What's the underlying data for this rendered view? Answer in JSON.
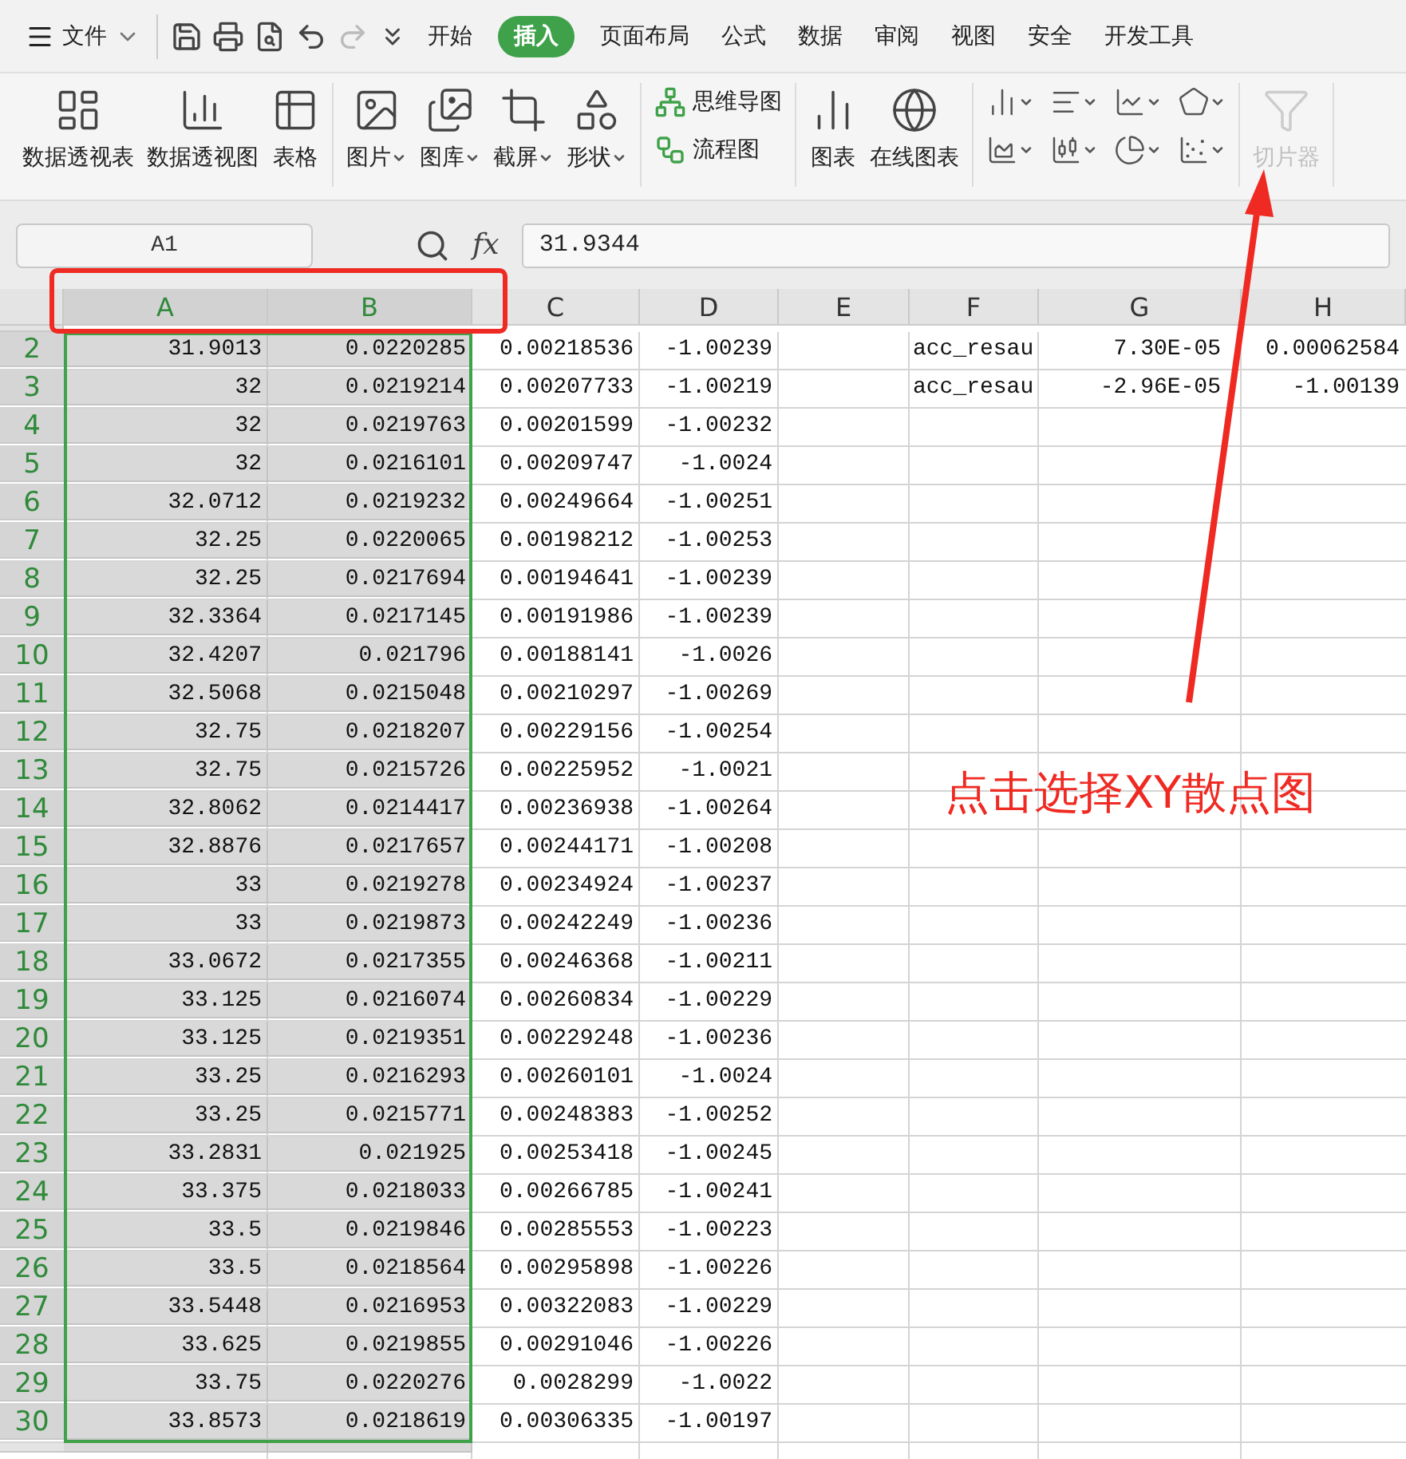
{
  "menu": {
    "label": "文件"
  },
  "tabs": [
    {
      "label": "开始",
      "selected": false
    },
    {
      "label": "插入",
      "selected": true
    },
    {
      "label": "页面布局",
      "selected": false
    },
    {
      "label": "公式",
      "selected": false
    },
    {
      "label": "数据",
      "selected": false
    },
    {
      "label": "审阅",
      "selected": false
    },
    {
      "label": "视图",
      "selected": false
    },
    {
      "label": "安全",
      "selected": false
    },
    {
      "label": "开发工具",
      "selected": false
    }
  ],
  "ribbon": [
    {
      "kind": "large",
      "items": [
        {
          "label": "数据透视表",
          "dropdown": false,
          "disabled": false
        },
        {
          "label": "数据透视图",
          "dropdown": false,
          "disabled": false
        },
        {
          "label": "表格",
          "dropdown": false,
          "disabled": false
        }
      ]
    },
    {
      "kind": "large",
      "items": [
        {
          "label": "图片",
          "dropdown": true,
          "disabled": false
        },
        {
          "label": "图库",
          "dropdown": true,
          "disabled": false
        },
        {
          "label": "截屏",
          "dropdown": true,
          "disabled": false
        },
        {
          "label": "形状",
          "dropdown": true,
          "disabled": false
        }
      ]
    },
    {
      "kind": "small",
      "items": [
        {
          "label": "思维导图"
        },
        {
          "label": "流程图"
        }
      ]
    },
    {
      "kind": "large",
      "items": [
        {
          "label": "图表",
          "dropdown": false,
          "disabled": false
        },
        {
          "label": "在线图表",
          "dropdown": false,
          "disabled": false
        }
      ]
    },
    {
      "kind": "icons",
      "items": [
        {
          "dropdown": true
        },
        {
          "dropdown": true
        },
        {
          "dropdown": true
        },
        {
          "dropdown": true
        },
        {
          "dropdown": true
        },
        {
          "dropdown": true
        },
        {
          "dropdown": true
        },
        {
          "dropdown": true
        }
      ]
    },
    {
      "kind": "large",
      "items": [
        {
          "label": "切片器",
          "dropdown": false,
          "disabled": true
        }
      ]
    }
  ],
  "formula_bar": {
    "name_box": "A1",
    "function_label": "fx",
    "formula": "31.9344"
  },
  "columns": [
    {
      "label": "A",
      "selected": true
    },
    {
      "label": "B",
      "selected": true
    },
    {
      "label": "C",
      "selected": false
    },
    {
      "label": "D",
      "selected": false
    },
    {
      "label": "E",
      "selected": false
    },
    {
      "label": "F",
      "selected": false
    },
    {
      "label": "G",
      "selected": false
    },
    {
      "label": "H",
      "selected": false
    }
  ],
  "rows": [
    {
      "number": "2",
      "selected": true,
      "cells": [
        "31.9013",
        "0.0220285",
        "0.00218536",
        "-1.00239",
        null,
        "acc_resau",
        "7.30E-05",
        "0.00062584"
      ]
    },
    {
      "number": "3",
      "selected": true,
      "cells": [
        "32",
        "0.0219214",
        "0.00207733",
        "-1.00219",
        null,
        "acc_resau",
        "-2.96E-05",
        "-1.00139"
      ]
    },
    {
      "number": "4",
      "selected": true,
      "cells": [
        "32",
        "0.0219763",
        "0.00201599",
        "-1.00232",
        null,
        null,
        null,
        null
      ]
    },
    {
      "number": "5",
      "selected": true,
      "cells": [
        "32",
        "0.0216101",
        "0.00209747",
        "-1.0024",
        null,
        null,
        null,
        null
      ]
    },
    {
      "number": "6",
      "selected": true,
      "cells": [
        "32.0712",
        "0.0219232",
        "0.00249664",
        "-1.00251",
        null,
        null,
        null,
        null
      ]
    },
    {
      "number": "7",
      "selected": true,
      "cells": [
        "32.25",
        "0.0220065",
        "0.00198212",
        "-1.00253",
        null,
        null,
        null,
        null
      ]
    },
    {
      "number": "8",
      "selected": true,
      "cells": [
        "32.25",
        "0.0217694",
        "0.00194641",
        "-1.00239",
        null,
        null,
        null,
        null
      ]
    },
    {
      "number": "9",
      "selected": true,
      "cells": [
        "32.3364",
        "0.0217145",
        "0.00191986",
        "-1.00239",
        null,
        null,
        null,
        null
      ]
    },
    {
      "number": "10",
      "selected": true,
      "cells": [
        "32.4207",
        "0.021796",
        "0.00188141",
        "-1.0026",
        null,
        null,
        null,
        null
      ]
    },
    {
      "number": "11",
      "selected": true,
      "cells": [
        "32.5068",
        "0.0215048",
        "0.00210297",
        "-1.00269",
        null,
        null,
        null,
        null
      ]
    },
    {
      "number": "12",
      "selected": true,
      "cells": [
        "32.75",
        "0.0218207",
        "0.00229156",
        "-1.00254",
        null,
        null,
        null,
        null
      ]
    },
    {
      "number": "13",
      "selected": true,
      "cells": [
        "32.75",
        "0.0215726",
        "0.00225952",
        "-1.0021",
        null,
        null,
        null,
        null
      ]
    },
    {
      "number": "14",
      "selected": true,
      "cells": [
        "32.8062",
        "0.0214417",
        "0.00236938",
        "-1.00264",
        null,
        null,
        null,
        null
      ]
    },
    {
      "number": "15",
      "selected": true,
      "cells": [
        "32.8876",
        "0.0217657",
        "0.00244171",
        "-1.00208",
        null,
        null,
        null,
        null
      ]
    },
    {
      "number": "16",
      "selected": true,
      "cells": [
        "33",
        "0.0219278",
        "0.00234924",
        "-1.00237",
        null,
        null,
        null,
        null
      ]
    },
    {
      "number": "17",
      "selected": true,
      "cells": [
        "33",
        "0.0219873",
        "0.00242249",
        "-1.00236",
        null,
        null,
        null,
        null
      ]
    },
    {
      "number": "18",
      "selected": true,
      "cells": [
        "33.0672",
        "0.0217355",
        "0.00246368",
        "-1.00211",
        null,
        null,
        null,
        null
      ]
    },
    {
      "number": "19",
      "selected": true,
      "cells": [
        "33.125",
        "0.0216074",
        "0.00260834",
        "-1.00229",
        null,
        null,
        null,
        null
      ]
    },
    {
      "number": "20",
      "selected": true,
      "cells": [
        "33.125",
        "0.0219351",
        "0.00229248",
        "-1.00236",
        null,
        null,
        null,
        null
      ]
    },
    {
      "number": "21",
      "selected": true,
      "cells": [
        "33.25",
        "0.0216293",
        "0.00260101",
        "-1.0024",
        null,
        null,
        null,
        null
      ]
    },
    {
      "number": "22",
      "selected": true,
      "cells": [
        "33.25",
        "0.0215771",
        "0.00248383",
        "-1.00252",
        null,
        null,
        null,
        null
      ]
    },
    {
      "number": "23",
      "selected": true,
      "cells": [
        "33.2831",
        "0.021925",
        "0.00253418",
        "-1.00245",
        null,
        null,
        null,
        null
      ]
    },
    {
      "number": "24",
      "selected": true,
      "cells": [
        "33.375",
        "0.0218033",
        "0.00266785",
        "-1.00241",
        null,
        null,
        null,
        null
      ]
    },
    {
      "number": "25",
      "selected": true,
      "cells": [
        "33.5",
        "0.0219846",
        "0.00285553",
        "-1.00223",
        null,
        null,
        null,
        null
      ]
    },
    {
      "number": "26",
      "selected": true,
      "cells": [
        "33.5",
        "0.0218564",
        "0.00295898",
        "-1.00226",
        null,
        null,
        null,
        null
      ]
    },
    {
      "number": "27",
      "selected": true,
      "cells": [
        "33.5448",
        "0.0216953",
        "0.00322083",
        "-1.00229",
        null,
        null,
        null,
        null
      ]
    },
    {
      "number": "28",
      "selected": true,
      "cells": [
        "33.625",
        "0.0219855",
        "0.00291046",
        "-1.00226",
        null,
        null,
        null,
        null
      ]
    },
    {
      "number": "29",
      "selected": true,
      "cells": [
        "33.75",
        "0.0220276",
        "0.0028299",
        "-1.0022",
        null,
        null,
        null,
        null
      ]
    },
    {
      "number": "30",
      "selected": true,
      "cells": [
        "33.8573",
        "0.0218619",
        "0.00306335",
        "-1.00197",
        null,
        null,
        null,
        null
      ]
    }
  ],
  "annotation": {
    "text": "点击选择XY散点图"
  }
}
